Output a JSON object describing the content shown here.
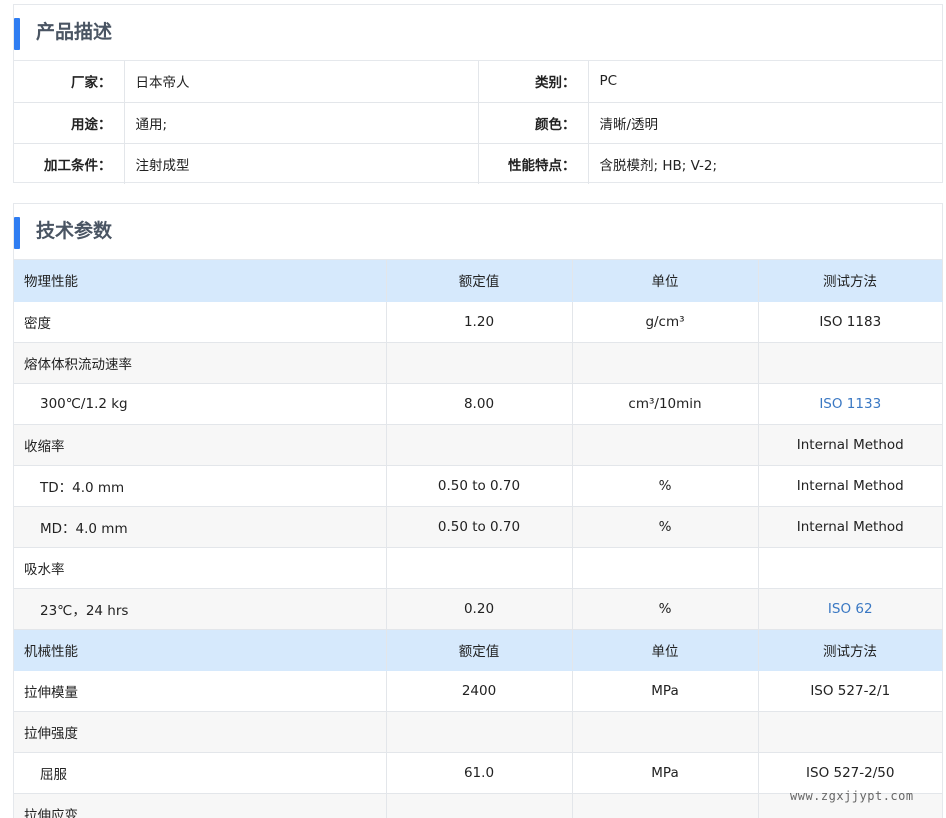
{
  "description": {
    "title": "产品描述",
    "rows": [
      {
        "label1": "厂家：",
        "value1": "日本帝人",
        "label2": "类别：",
        "value2": "PC"
      },
      {
        "label1": "用途：",
        "value1": "通用;",
        "label2": "颜色：",
        "value2": "清晰/透明"
      },
      {
        "label1": "加工条件：",
        "value1": "注射成型",
        "label2": "性能特点：",
        "value2": "含脱模剂; HB; V-2;"
      }
    ]
  },
  "technical": {
    "title": "技术参数",
    "rows": [
      {
        "type": "header",
        "cells": [
          "物理性能",
          "额定值",
          "单位",
          "测试方法"
        ]
      },
      {
        "type": "row",
        "cells": [
          "密度",
          "1.20",
          "g/cm³",
          "ISO 1183"
        ],
        "link": false
      },
      {
        "type": "row",
        "cells": [
          "熔体体积流动速率",
          "",
          "",
          ""
        ],
        "link": false
      },
      {
        "type": "sub",
        "cells": [
          "300℃/1.2 kg",
          "8.00",
          "cm³/10min",
          "ISO 1133"
        ],
        "link": true
      },
      {
        "type": "row",
        "cells": [
          "收缩率",
          "",
          "",
          "Internal Method"
        ],
        "link": false
      },
      {
        "type": "sub",
        "cells": [
          "TD：4.0 mm",
          "0.50 to 0.70",
          "%",
          "Internal Method"
        ],
        "link": false
      },
      {
        "type": "sub",
        "cells": [
          "MD：4.0 mm",
          "0.50 to 0.70",
          "%",
          "Internal Method"
        ],
        "link": false
      },
      {
        "type": "row",
        "cells": [
          "吸水率",
          "",
          "",
          ""
        ],
        "link": false
      },
      {
        "type": "sub",
        "cells": [
          "23℃，24 hrs",
          "0.20",
          "%",
          "ISO 62"
        ],
        "link": true
      },
      {
        "type": "header",
        "cells": [
          "机械性能",
          "额定值",
          "单位",
          "测试方法"
        ]
      },
      {
        "type": "row",
        "cells": [
          "拉伸模量",
          "2400",
          "MPa",
          "ISO 527-2/1"
        ],
        "link": false
      },
      {
        "type": "row",
        "cells": [
          "拉伸强度",
          "",
          "",
          ""
        ],
        "link": false
      },
      {
        "type": "sub",
        "cells": [
          "屈服",
          "61.0",
          "MPa",
          "ISO 527-2/50"
        ],
        "link": false
      },
      {
        "type": "row",
        "cells": [
          "拉伸应变",
          "",
          "",
          ""
        ],
        "link": false
      }
    ]
  },
  "watermark": "www.zgxjjypt.com",
  "colors": {
    "accent": "#2f7df2",
    "header_bg": "#d6e9fc",
    "link": "#3a78c3"
  }
}
